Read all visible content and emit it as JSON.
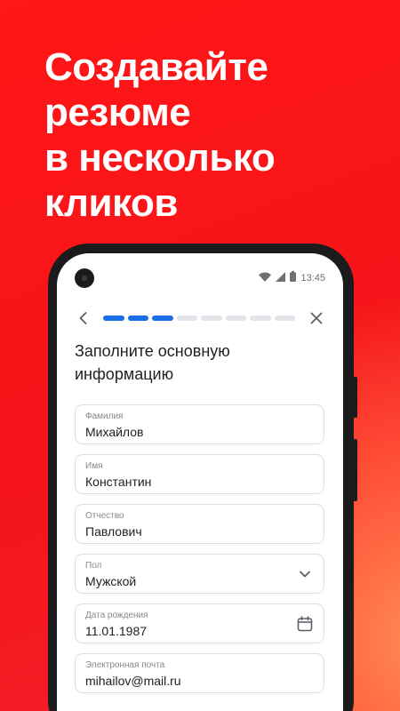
{
  "headline": [
    "Создавайте",
    "резюме",
    "в несколько",
    "кликов"
  ],
  "status": {
    "time": "13:45"
  },
  "progress": {
    "total": 8,
    "done": 3
  },
  "form": {
    "title": "Заполните основную информацию",
    "fields": [
      {
        "label": "Фамилия",
        "value": "Михайлов"
      },
      {
        "label": "Имя",
        "value": "Константин"
      },
      {
        "label": "Отчество",
        "value": "Павлович"
      },
      {
        "label": "Пол",
        "value": "Мужской",
        "icon": "chevron-down-icon"
      },
      {
        "label": "Дата рождения",
        "value": "11.01.1987",
        "icon": "calendar-icon"
      },
      {
        "label": "Электронная почта",
        "value": "mihailov@mail.ru"
      }
    ]
  },
  "colors": {
    "background": "#f5141a",
    "accent": "#1a6fe6"
  }
}
